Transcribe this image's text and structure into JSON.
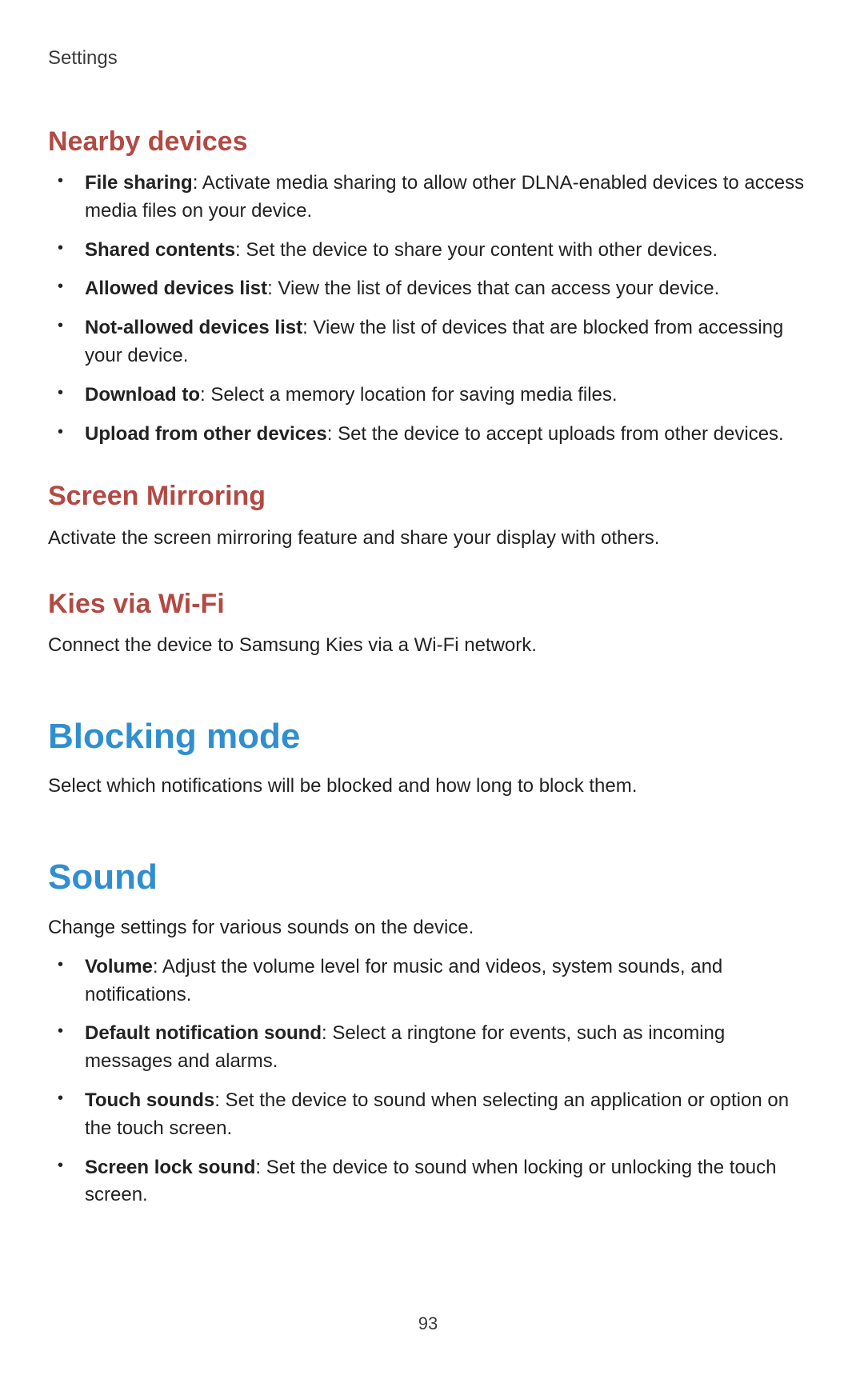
{
  "header": {
    "app_title": "Settings"
  },
  "sections": {
    "nearby_devices": {
      "title": "Nearby devices",
      "items": [
        {
          "term": "File sharing",
          "desc": ": Activate media sharing to allow other DLNA-enabled devices to access media files on your device."
        },
        {
          "term": "Shared contents",
          "desc": ": Set the device to share your content with other devices."
        },
        {
          "term": "Allowed devices list",
          "desc": ": View the list of devices that can access your device."
        },
        {
          "term": "Not-allowed devices list",
          "desc": ": View the list of devices that are blocked from accessing your device."
        },
        {
          "term": "Download to",
          "desc": ": Select a memory location for saving media files."
        },
        {
          "term": "Upload from other devices",
          "desc": ": Set the device to accept uploads from other devices."
        }
      ]
    },
    "screen_mirroring": {
      "title": "Screen Mirroring",
      "body": "Activate the screen mirroring feature and share your display with others."
    },
    "kies": {
      "title": "Kies via Wi-Fi",
      "body": "Connect the device to Samsung Kies via a Wi-Fi network."
    },
    "blocking_mode": {
      "title": "Blocking mode",
      "body": "Select which notifications will be blocked and how long to block them."
    },
    "sound": {
      "title": "Sound",
      "body": "Change settings for various sounds on the device.",
      "items": [
        {
          "term": "Volume",
          "desc": ": Adjust the volume level for music and videos, system sounds, and notifications."
        },
        {
          "term": "Default notification sound",
          "desc": ": Select a ringtone for events, such as incoming messages and alarms."
        },
        {
          "term": "Touch sounds",
          "desc": ": Set the device to sound when selecting an application or option on the touch screen."
        },
        {
          "term": "Screen lock sound",
          "desc": ": Set the device to sound when locking or unlocking the touch screen."
        }
      ]
    }
  },
  "page_number": "93"
}
